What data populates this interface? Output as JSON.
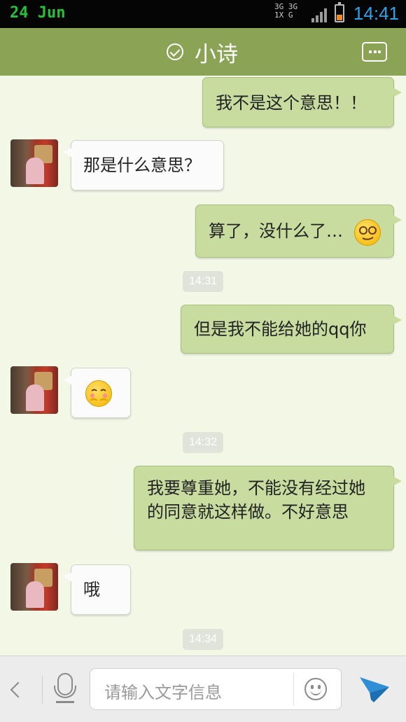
{
  "status_bar": {
    "date": "24 Jun",
    "network": "3G 3G 1X G",
    "time": "14:41",
    "battery_color": "#f08a1b"
  },
  "header": {
    "title": "小诗",
    "verified_icon": "check-circle-icon",
    "more_icon": "more-dots-icon",
    "background": "#8aa355"
  },
  "messages": [
    {
      "side": "out",
      "text": "我不是这个意思！！"
    },
    {
      "side": "in",
      "text": "那是什么意思？"
    },
    {
      "side": "out",
      "text": "算了，没什么了…",
      "emoji": "squint-smile-emoji"
    },
    {
      "side": "time",
      "text": "14:31"
    },
    {
      "side": "out",
      "text": "但是我不能给她的qq你"
    },
    {
      "side": "in",
      "text": "",
      "emoji": "shy-face-emoji"
    },
    {
      "side": "time",
      "text": "14:32"
    },
    {
      "side": "out",
      "text": "我要尊重她，不能没有经过她的同意就这样做。不好意思"
    },
    {
      "side": "in",
      "text": "哦"
    },
    {
      "side": "time",
      "text": "14:34"
    }
  ],
  "input_bar": {
    "back_icon": "chevron-left-icon",
    "voice_icon": "microphone-icon",
    "placeholder": "请输入文字信息",
    "emoji_icon": "smiley-icon",
    "send_icon": "paper-plane-icon",
    "send_color": "#2f8fd6"
  }
}
